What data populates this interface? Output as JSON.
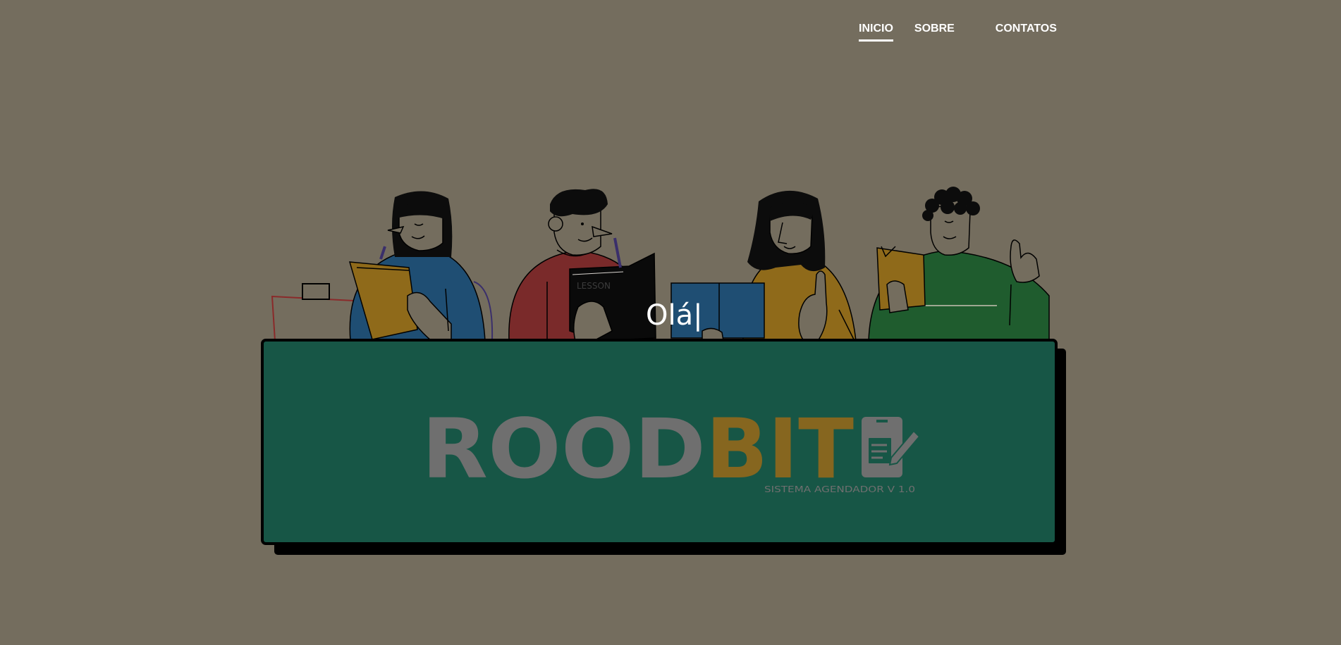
{
  "nav": {
    "items": [
      {
        "label": "INICIO",
        "active": true
      },
      {
        "label": "SOBRE",
        "active": false
      },
      {
        "label": "CONTATOS",
        "active": false
      }
    ]
  },
  "hero": {
    "greeting": "Olá",
    "cursor": "|"
  },
  "logo": {
    "part1": "ROOD",
    "part2": "BIT",
    "tagline": "SISTEMA AGENDADOR V 1.0",
    "icon": "phone-form-pencil-icon"
  },
  "colors": {
    "background": "#746d5e",
    "board": "#175646",
    "board_shadow": "#000000",
    "logo_gray": "#6f6f6f",
    "logo_gold": "#86661f",
    "blue": "#1f4e73",
    "red": "#7a2a2a",
    "mustard": "#8f6a1a",
    "green": "#1f5c2e"
  }
}
